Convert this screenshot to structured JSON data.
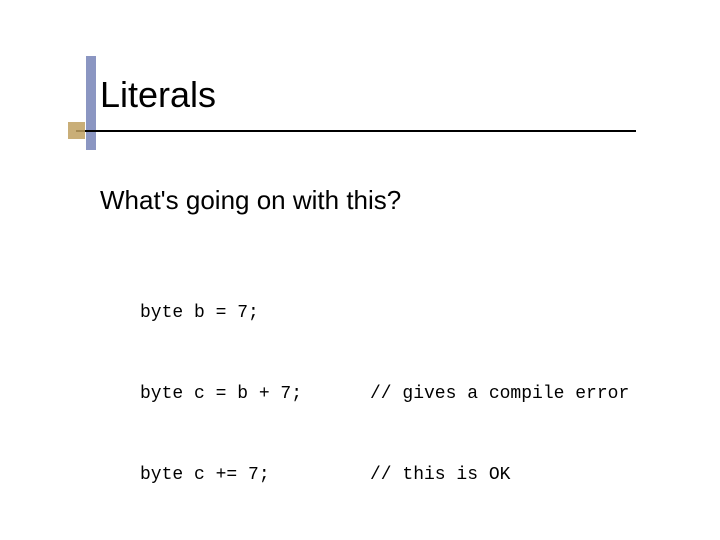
{
  "title": "Literals",
  "subtitle": "What's going on with this?",
  "code": {
    "lines": [
      {
        "stmt": "byte b = 7;",
        "comment": ""
      },
      {
        "stmt": "byte c = b + 7;",
        "comment": "// gives a compile error"
      },
      {
        "stmt": "byte c += 7;",
        "comment": "// this is OK"
      }
    ]
  }
}
